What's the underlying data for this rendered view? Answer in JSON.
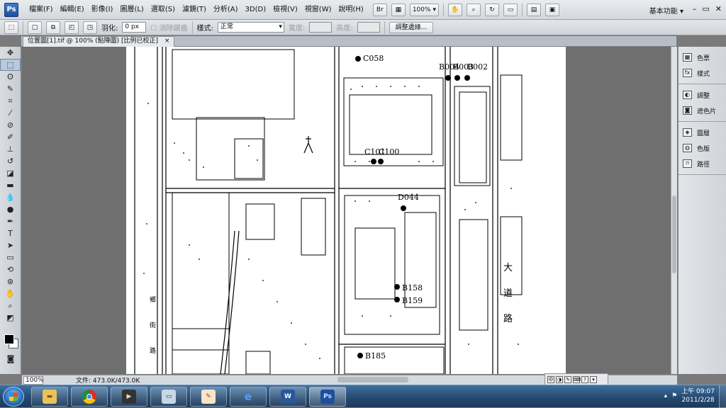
{
  "app": {
    "logo": "Ps",
    "menu": [
      "檔案(F)",
      "編輯(E)",
      "影像(I)",
      "圖層(L)",
      "選取(S)",
      "濾鏡(T)",
      "分析(A)",
      "3D(D)",
      "檢視(V)",
      "視窗(W)",
      "說明(H)"
    ],
    "toolbar": {
      "bridge": "Br",
      "zoom": "100%",
      "zoom_arrow": "▾"
    },
    "workspace": "基本功能 ▾",
    "window_controls": [
      "–",
      "▭",
      "✕"
    ]
  },
  "options": {
    "feather_label": "羽化:",
    "feather_value": "0 px",
    "antialias_label": "消除鋸齒",
    "style_label": "樣式:",
    "style_value": "正常",
    "width_label": "寬度:",
    "height_label": "高度:",
    "refine_edge": "調整邊緣..."
  },
  "document": {
    "tab_title": "位置圖[1].tif @ 100% (點陣圖) [比例已校正]",
    "tab_close": "×"
  },
  "map_labels": {
    "c058": "C058",
    "b004": "B004",
    "b003": "B003",
    "b002": "B002",
    "c101": "C101",
    "c100": "C100",
    "d044": "D044",
    "b158": "B158",
    "b159": "B159",
    "b185": "B185",
    "street_1": "大",
    "street_2": "道",
    "street_3": "路",
    "street_left_1": "鄉",
    "street_left_2": "街",
    "street_left_3": "路"
  },
  "status": {
    "zoom": "100%",
    "doc_info": "文件: 473.0K/473.0K"
  },
  "panels": [
    {
      "label": "色票",
      "icon": "swatches-icon"
    },
    {
      "label": "樣式",
      "icon": "styles-icon"
    },
    {
      "label": "調整",
      "icon": "adjustments-icon"
    },
    {
      "label": "遮色片",
      "icon": "masks-icon"
    },
    {
      "label": "圖層",
      "icon": "layers-icon"
    },
    {
      "label": "色版",
      "icon": "channels-icon"
    },
    {
      "label": "路徑",
      "icon": "paths-icon"
    }
  ],
  "taskbar": {
    "apps": [
      "folder",
      "chrome",
      "media",
      "scanner",
      "paint",
      "ie",
      "word",
      "photoshop"
    ],
    "ps_label": "Ps",
    "word_label": "W",
    "clock_time": "上午 09:07",
    "clock_date": "2011/2/28"
  },
  "colors": {
    "accent": "#1f4f9a",
    "taskbar": "#24476d"
  }
}
